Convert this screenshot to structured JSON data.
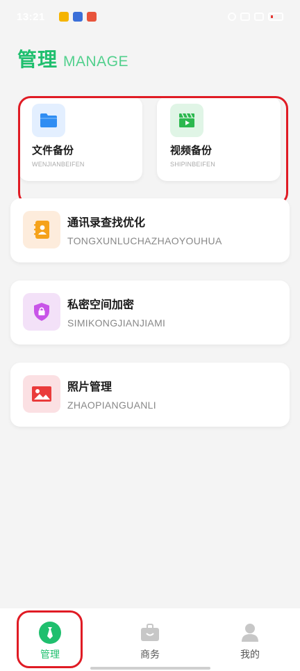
{
  "status": {
    "time": "13:21"
  },
  "header": {
    "title": "管理",
    "subtitle": "MANAGE"
  },
  "cards": [
    {
      "title": "文件备份",
      "subtitle": "WENJIANBEIFEN",
      "icon": "folder-icon",
      "icon_color": "#2f8df3",
      "icon_bg": "#e3efff"
    },
    {
      "title": "视频备份",
      "subtitle": "SHIPINBEIFEN",
      "icon": "video-icon",
      "icon_color": "#2cb84f",
      "icon_bg": "#e0f5e6"
    },
    {
      "title": "通讯录查找优化",
      "subtitle": "TONGXUNLUCHAZHAOYOUHUA",
      "icon": "contacts-icon",
      "icon_color": "#f5a21b",
      "icon_bg": "#fdecdc"
    },
    {
      "title": "私密空间加密",
      "subtitle": "SIMIKONGJIANJIAMI",
      "icon": "shield-lock-icon",
      "icon_color": "#c855e8",
      "icon_bg": "#f3e1f8"
    },
    {
      "title": "照片管理",
      "subtitle": "ZHAOPIANGUANLI",
      "icon": "photo-icon",
      "icon_color": "#ea3b3b",
      "icon_bg": "#fbe0e3"
    }
  ],
  "tabs": [
    {
      "label": "管理",
      "icon": "manage-icon",
      "active": true
    },
    {
      "label": "商务",
      "icon": "briefcase-icon",
      "active": false
    },
    {
      "label": "我的",
      "icon": "profile-icon",
      "active": false
    }
  ],
  "colors": {
    "accent": "#1fbf6e",
    "highlight": "#e01b24",
    "background": "#f4f4f4"
  }
}
